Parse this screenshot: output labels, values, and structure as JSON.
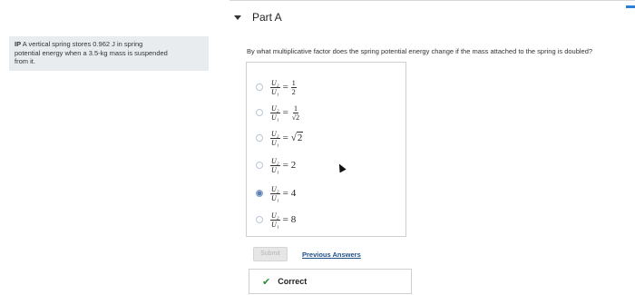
{
  "part": {
    "title": "Part A"
  },
  "problem": {
    "prefix": "IP",
    "text_line1": "A vertical spring stores 0.962 J in spring",
    "text_line2": "potential energy when a 3.5-kg mass is suspended",
    "text_line3": "from it."
  },
  "question": "By what multiplicative factor does the spring potential energy change if the mass attached to the spring is doubled?",
  "choices": [
    {
      "num": "U₂",
      "den": "U₁",
      "rhs_num": "1",
      "rhs_den": "2"
    },
    {
      "num": "U₂",
      "den": "U₁",
      "rhs_num": "1",
      "rhs_den": "√2"
    },
    {
      "num": "U₂",
      "den": "U₁",
      "rhs_sqrt": "2"
    },
    {
      "num": "U₂",
      "den": "U₁",
      "rhs": "2"
    },
    {
      "num": "U₂",
      "den": "U₁",
      "rhs": "4"
    },
    {
      "num": "U₂",
      "den": "U₁",
      "rhs": "8"
    }
  ],
  "selected_choice": "4",
  "buttons": {
    "submit": "Submit",
    "previous": "Previous Answers"
  },
  "feedback": {
    "icon": "check-icon",
    "text": "Correct",
    "color": "#2f8a3a"
  }
}
